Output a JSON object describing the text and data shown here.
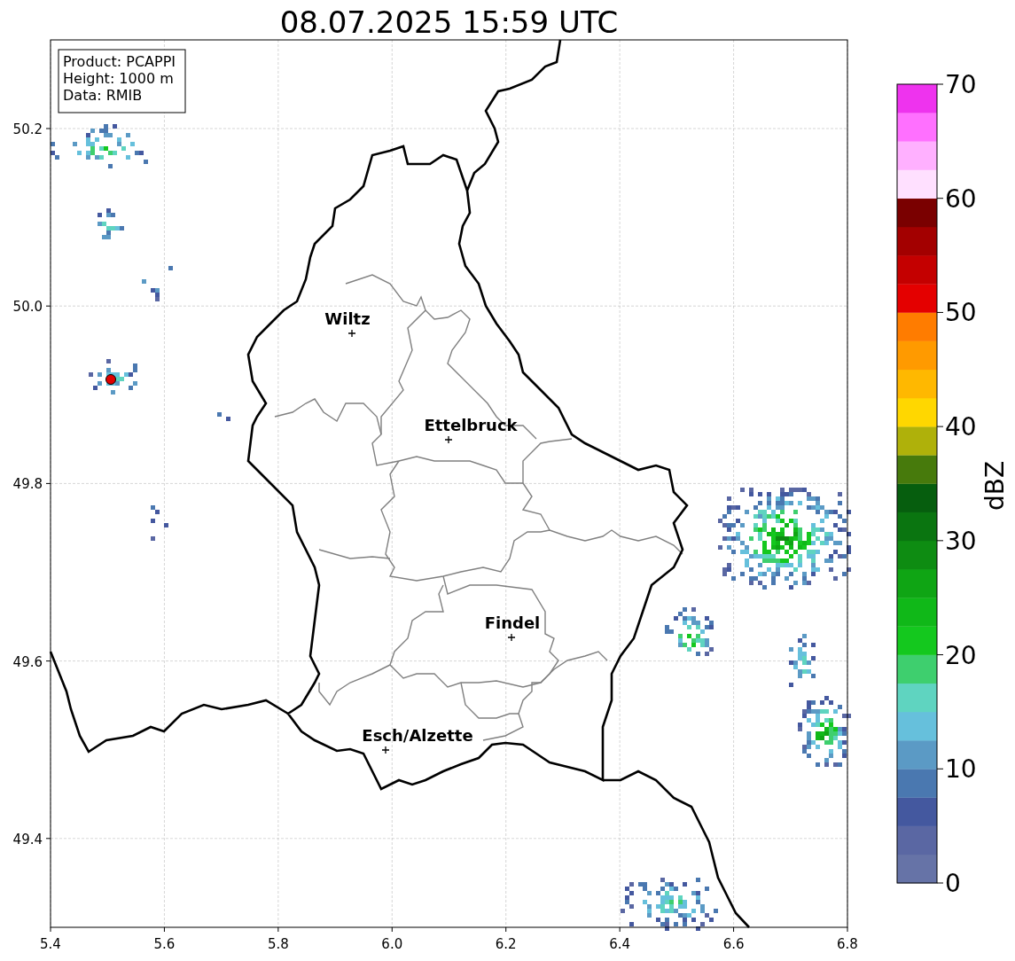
{
  "title": "08.07.2025 15:59 UTC",
  "info_box": [
    "Product: PCAPPI",
    "Height: 1000 m",
    "Data: RMIB"
  ],
  "map": {
    "x_ticks": [
      "5.4",
      "5.6",
      "5.8",
      "6.0",
      "6.2",
      "6.4",
      "6.6",
      "6.8"
    ],
    "y_ticks": [
      "50.2",
      "50.0",
      "49.8",
      "49.6",
      "49.4"
    ],
    "cities": [
      {
        "name": "Wiltz"
      },
      {
        "name": "Ettelbruck"
      },
      {
        "name": "Findel"
      },
      {
        "name": "Esch/Alzette"
      }
    ]
  },
  "colorbar": {
    "label": "dBZ",
    "ticks": [
      "70",
      "60",
      "50",
      "40",
      "30",
      "20",
      "10",
      "0"
    ],
    "bands": [
      {
        "color": "#6673a7"
      },
      {
        "color": "#5a67a3"
      },
      {
        "color": "#44589f"
      },
      {
        "color": "#4a78b0"
      },
      {
        "color": "#5b9ac5"
      },
      {
        "color": "#66c0dc"
      },
      {
        "color": "#5fd4c0"
      },
      {
        "color": "#3ecf6e"
      },
      {
        "color": "#14c81e"
      },
      {
        "color": "#10b818"
      },
      {
        "color": "#0fa514"
      },
      {
        "color": "#0e8c12"
      },
      {
        "color": "#0a7510"
      },
      {
        "color": "#065e0e"
      },
      {
        "color": "#477a0c"
      },
      {
        "color": "#afb10a"
      },
      {
        "color": "#ffd700"
      },
      {
        "color": "#ffb800"
      },
      {
        "color": "#ff9a00"
      },
      {
        "color": "#ff7c00"
      },
      {
        "color": "#e40000"
      },
      {
        "color": "#c40000"
      },
      {
        "color": "#a30000"
      },
      {
        "color": "#7a0000"
      },
      {
        "color": "#ffe0ff"
      },
      {
        "color": "#ffb0ff"
      },
      {
        "color": "#ff70ff"
      },
      {
        "color": "#ee33ee"
      }
    ]
  }
}
